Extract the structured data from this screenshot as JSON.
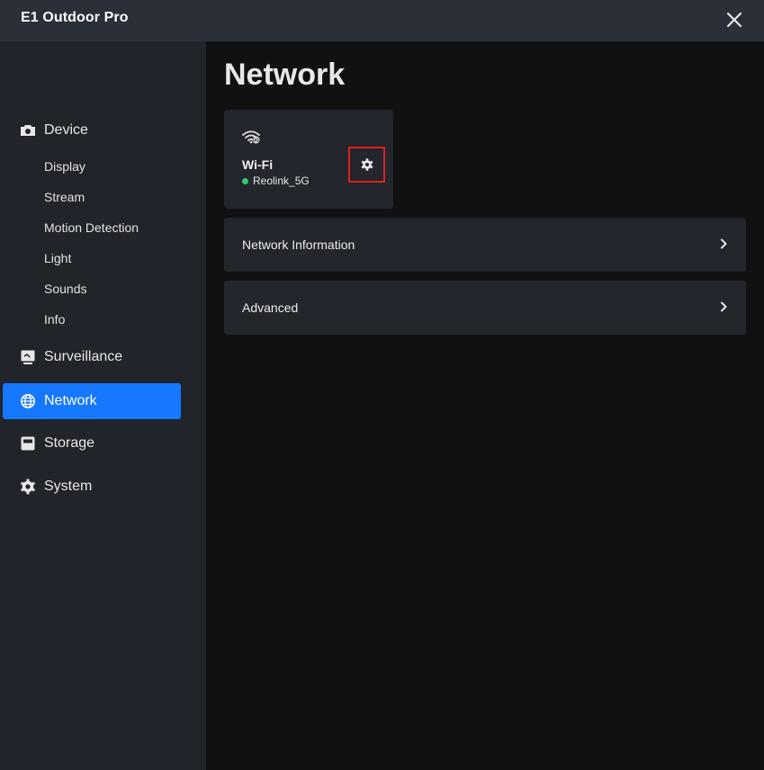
{
  "window": {
    "title": "E1 Outdoor Pro",
    "close_icon": "close-icon"
  },
  "sidebar": {
    "items": [
      {
        "label": "Device",
        "icon": "camera-icon",
        "active": false,
        "subitems": [
          "Display",
          "Stream",
          "Motion Detection",
          "Light",
          "Sounds",
          "Info"
        ]
      },
      {
        "label": "Surveillance",
        "icon": "monitor-icon",
        "active": false
      },
      {
        "label": "Network",
        "icon": "globe-icon",
        "active": true
      },
      {
        "label": "Storage",
        "icon": "storage-icon",
        "active": false
      },
      {
        "label": "System",
        "icon": "gear-icon",
        "active": false
      }
    ]
  },
  "main": {
    "title": "Network",
    "wifi_card": {
      "icon": "wifi-5g-icon",
      "title": "Wi-Fi",
      "ssid": "Reolink_5G",
      "status_color": "#2ecc71",
      "settings_icon": "gear-icon"
    },
    "rows": [
      {
        "label": "Network Information",
        "icon": "chevron-right-icon"
      },
      {
        "label": "Advanced",
        "icon": "chevron-right-icon"
      }
    ]
  },
  "colors": {
    "accent": "#1677ff",
    "highlight_box": "#e0201c"
  }
}
